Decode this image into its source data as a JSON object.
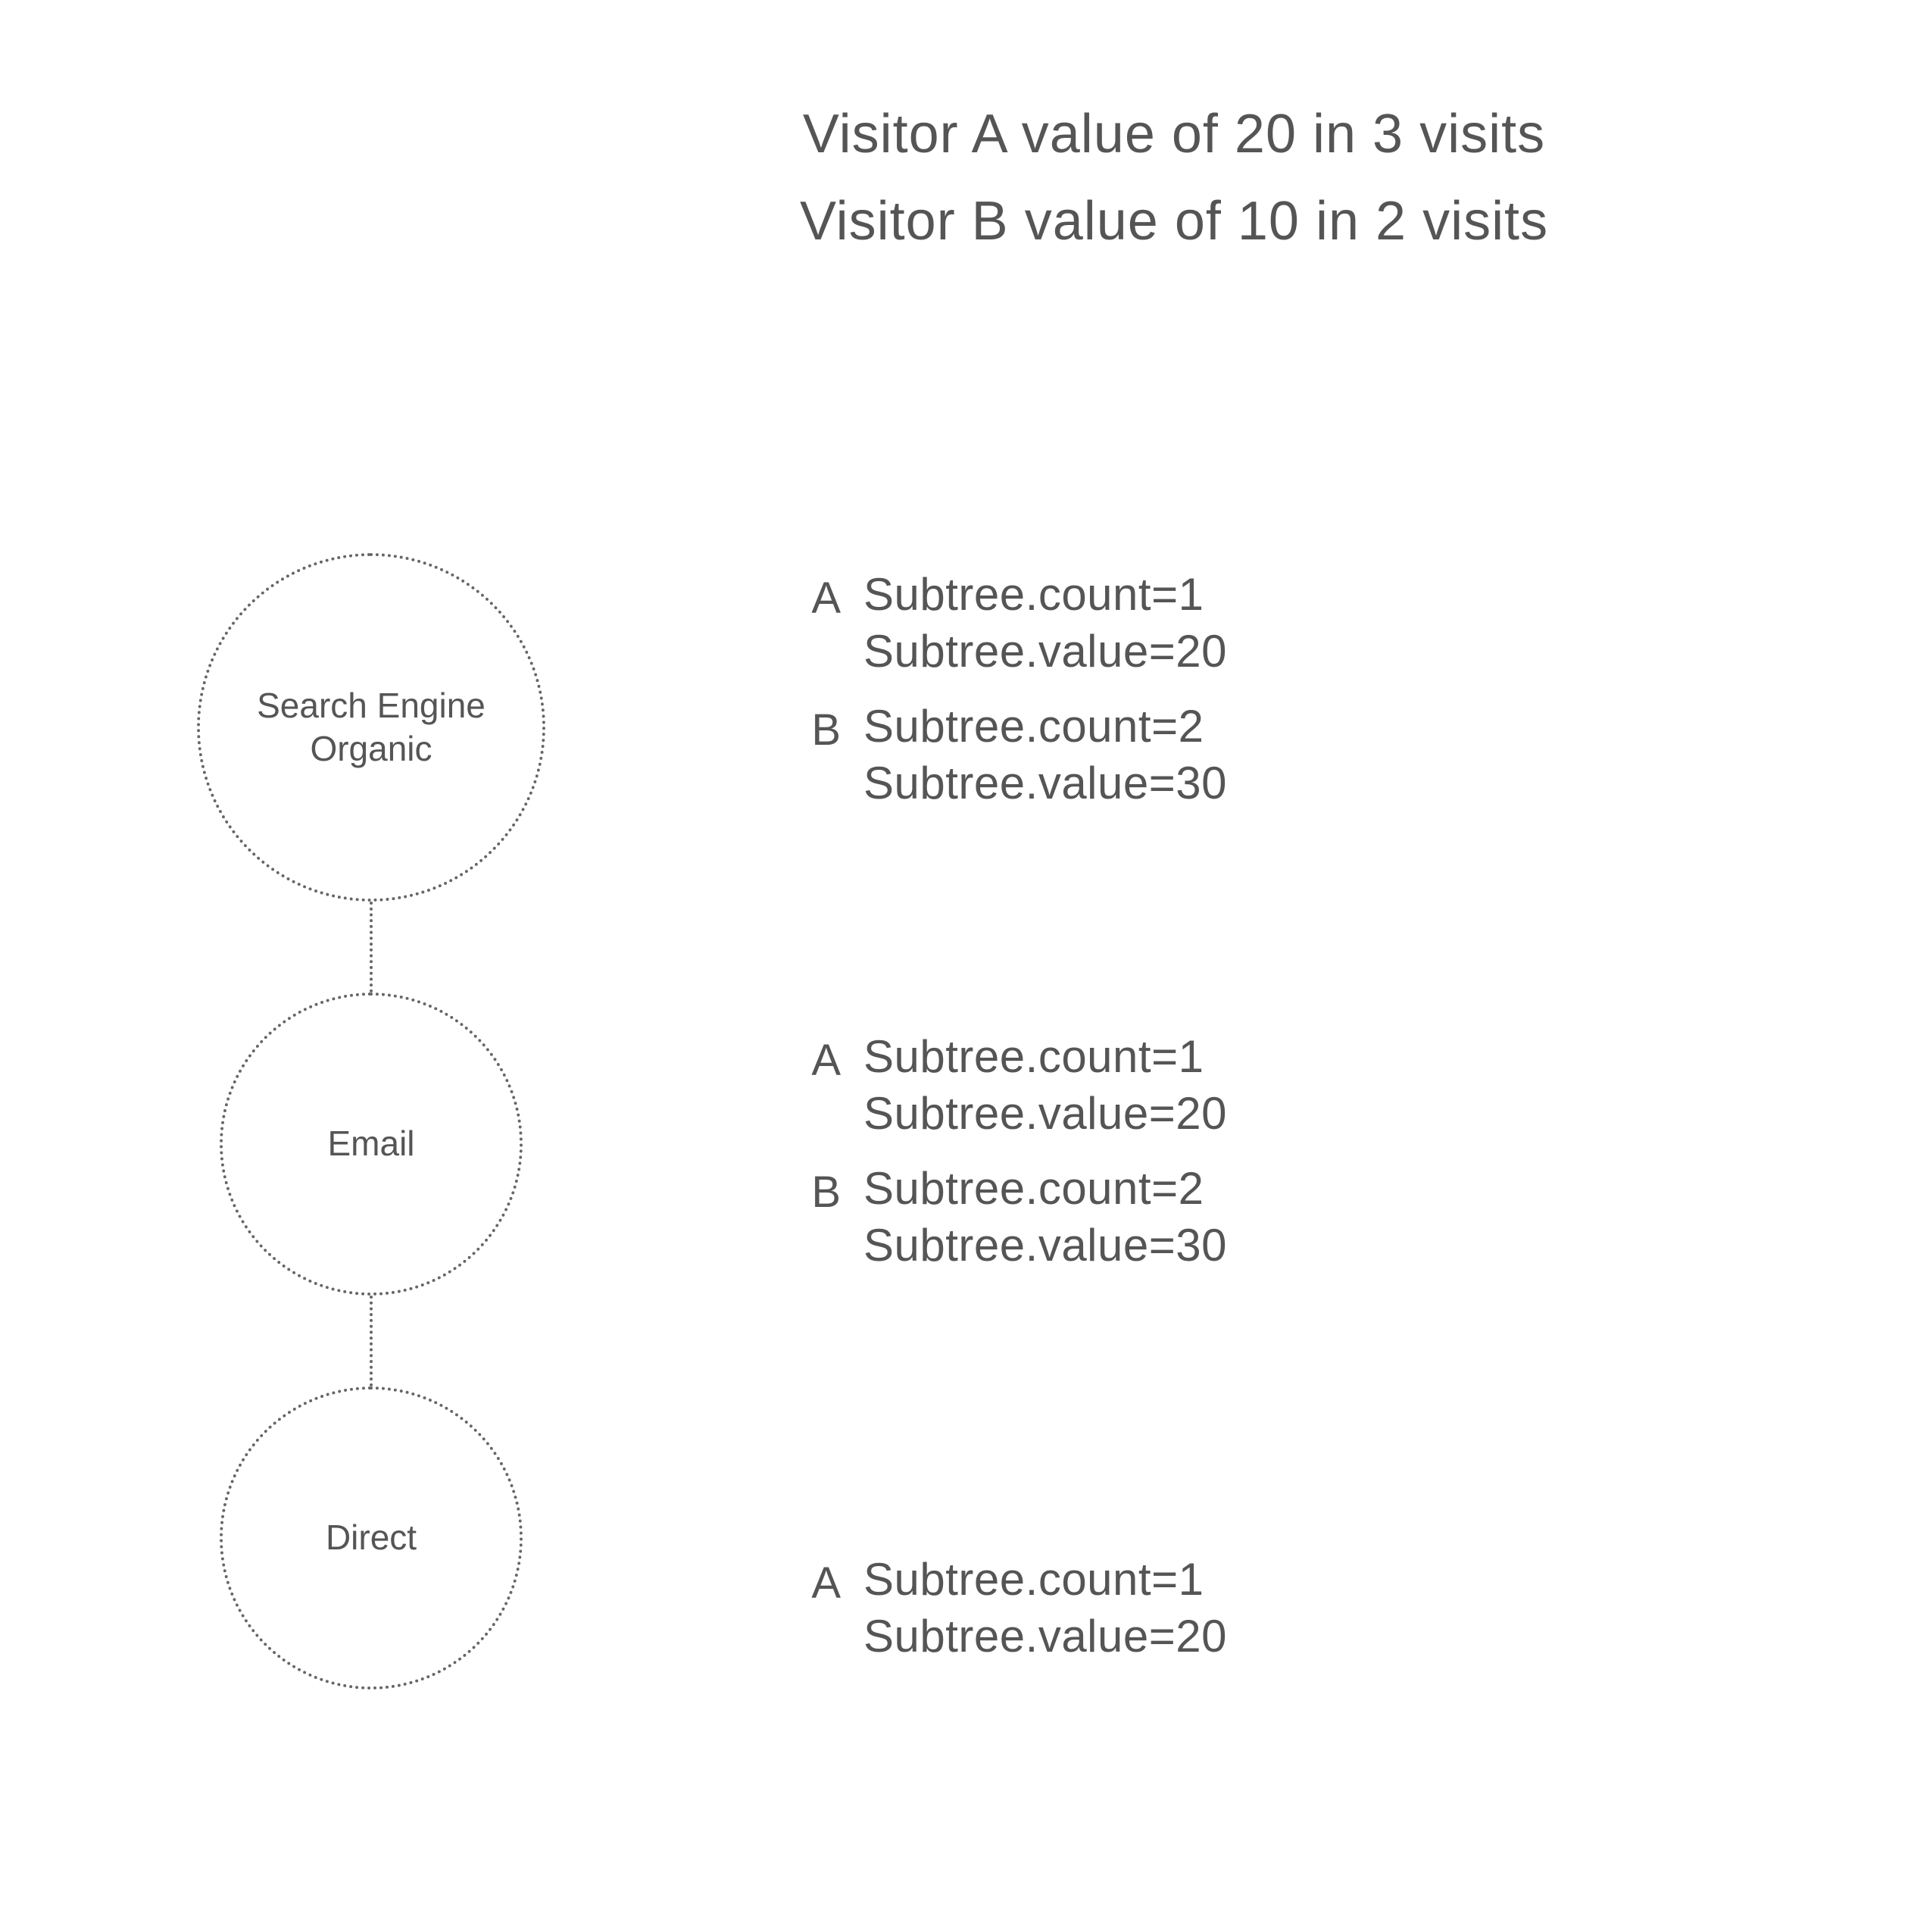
{
  "header": {
    "line1": "Visitor A value of 20 in 3 visits",
    "line2": "Visitor B value of 10  in 2 visits"
  },
  "nodes": [
    {
      "label": "Search Engine Organic"
    },
    {
      "label": "Email"
    },
    {
      "label": "Direct"
    }
  ],
  "groups": [
    {
      "blocks": [
        {
          "letter": "A",
          "l1": "Subtree.count=1",
          "l2": "Subtree.value=20"
        },
        {
          "letter": "B",
          "l1": "Subtree.count=2",
          "l2": "Subtree.value=30"
        }
      ]
    },
    {
      "blocks": [
        {
          "letter": "A",
          "l1": "Subtree.count=1",
          "l2": "Subtree.value=20"
        },
        {
          "letter": "B",
          "l1": "Subtree.count=2",
          "l2": "Subtree.value=30"
        }
      ]
    },
    {
      "blocks": [
        {
          "letter": "A",
          "l1": "Subtree.count=1",
          "l2": "Subtree.value=20"
        }
      ]
    }
  ]
}
